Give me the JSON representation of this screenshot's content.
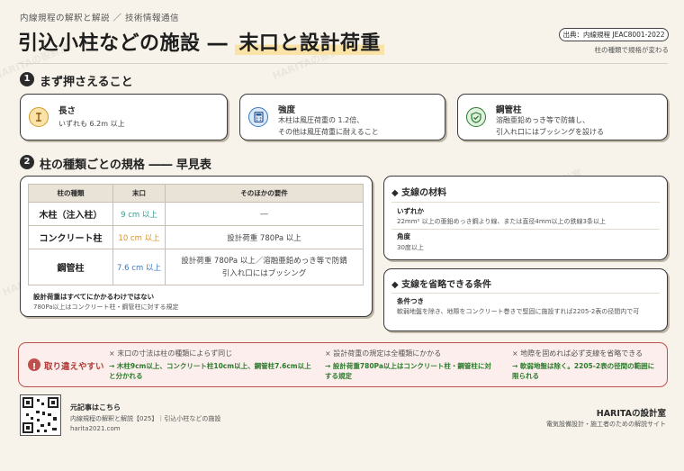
{
  "header": {
    "kicker": "内線規程の解釈と解説 ／ 技術情報通信",
    "title_main": "引込小柱などの施設 ―",
    "title_highlight": "末口と設計荷重",
    "source": "出典：内線規程 JEAC8001-2022",
    "source_note": "柱の種類で規格が変わる"
  },
  "section1": {
    "number": "1",
    "title": "まず押さえること",
    "cards": [
      {
        "icon": "ruler-icon",
        "title": "長さ",
        "body": "いずれも 6.2m 以上"
      },
      {
        "icon": "calculator-icon",
        "title": "強度",
        "body": "木柱は風圧荷重の 1.2倍、\nその他は風圧荷重に耐えること"
      },
      {
        "icon": "shield-check-icon",
        "title": "鋼管柱",
        "body": "溶融亜鉛めっき等で防錆し、\n引入れ口にはブッシングを設ける"
      }
    ]
  },
  "section2": {
    "number": "2",
    "title": "柱の種類ごとの規格 ―― 早見表",
    "table": {
      "headers": [
        "柱の種類",
        "末口",
        "そのほかの要件"
      ],
      "rows": [
        {
          "name": "木柱（注入柱）",
          "size": "9 cm 以上",
          "req": "―",
          "color": "#2e9e8f"
        },
        {
          "name": "コンクリート柱",
          "size": "10 cm 以上",
          "req": "設計荷重 780Pa 以上",
          "color": "#d9902a"
        },
        {
          "name": "鋼管柱",
          "size": "7.6 cm 以上",
          "req": "設計荷重 780Pa 以上／溶融亜鉛めっき等で防錆\n引入れ口にはブッシング",
          "color": "#3a78c2"
        }
      ]
    },
    "note_title": "設計荷重はすべてにかかるわけではない",
    "note_body": "780Pa以上はコンクリート柱・鋼管柱に対する規定"
  },
  "materials": {
    "title": "◆ 支線の材料",
    "items": [
      {
        "label": "いずれか",
        "text": "22mm² 以上の亜鉛めっき鋼より線、または直径4mm以上の鉄線3条以上"
      },
      {
        "label": "角度",
        "text": "30度以上"
      }
    ]
  },
  "omit": {
    "title": "◆ 支線を省略できる条件",
    "label": "条件つき",
    "text": "軟弱地盤を除き、地際をコンクリート巻きで堅固に施設すれば2205-2表の径間内で可"
  },
  "warning": {
    "label": "取り違えやすい",
    "items": [
      {
        "wrong": "末口の寸法は柱の種類によらず同じ",
        "right": "→ 木柱9cm以上、コンクリート柱10cm以上、鋼管柱7.6cm以上と分かれる"
      },
      {
        "wrong": "設計荷重の規定は全種類にかかる",
        "right": "→ 設計荷重780Pa以上はコンクリート柱・鋼管柱に対する規定"
      },
      {
        "wrong": "地際を固めれば必ず支線を省略できる",
        "right": "→ 軟弱地盤は除く。2205-2表の径間の範囲に限られる"
      }
    ]
  },
  "footer": {
    "qr_title": "元記事はこちら",
    "qr_sub": "内線規程の解釈と解説【025】｜引込小柱などの施設",
    "qr_url": "harita2021.com",
    "brand": "HARITAの設計室",
    "brand_sub": "電気設備設計・施工者のための解説サイト"
  },
  "watermark": "HARITAの設計室",
  "colors": {
    "accent": "#fbe3a8",
    "warn": "#c0504d",
    "ok": "#2b7a2b"
  }
}
